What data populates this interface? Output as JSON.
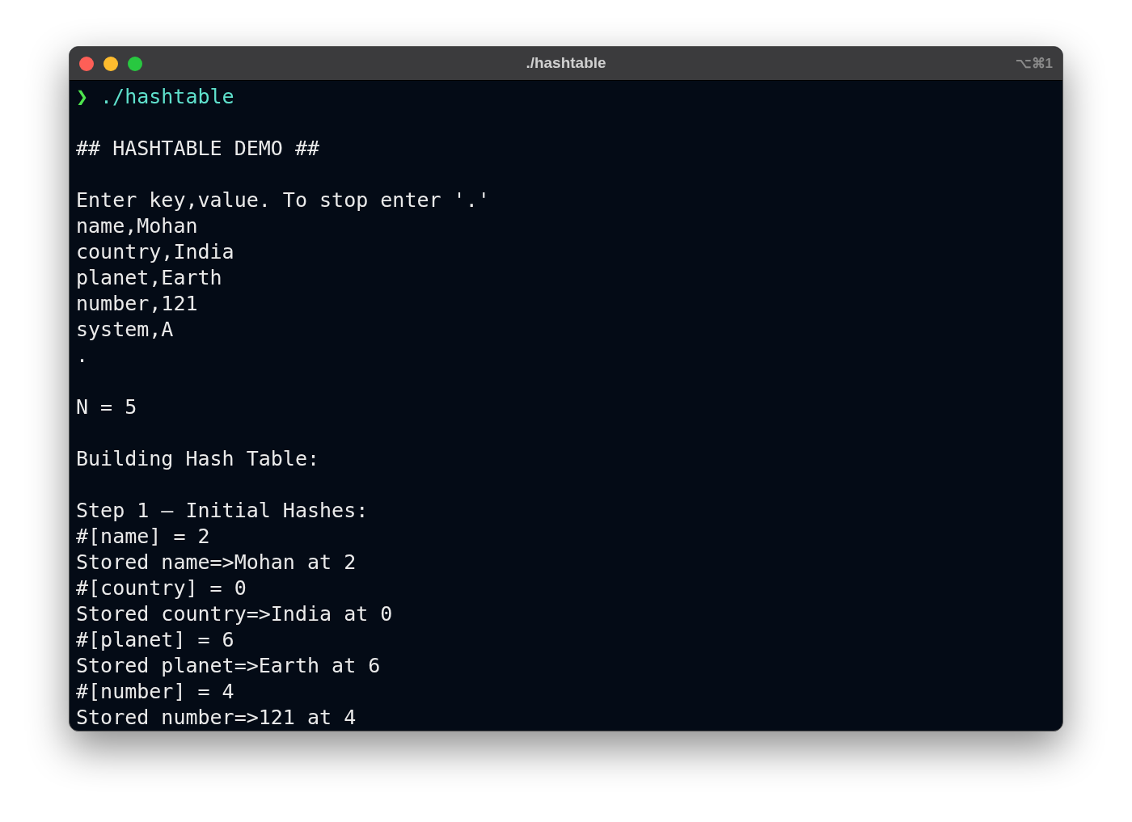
{
  "window": {
    "title": "./hashtable",
    "shortcut": "⌥⌘1"
  },
  "terminal": {
    "lines": [
      {
        "kind": "prompt",
        "symbol": "❯",
        "text": "./hashtable"
      },
      {
        "kind": "blank"
      },
      {
        "kind": "output",
        "text": "## HASHTABLE DEMO ##"
      },
      {
        "kind": "blank"
      },
      {
        "kind": "output",
        "text": "Enter key,value. To stop enter '.'"
      },
      {
        "kind": "output",
        "text": "name,Mohan"
      },
      {
        "kind": "output",
        "text": "country,India"
      },
      {
        "kind": "output",
        "text": "planet,Earth"
      },
      {
        "kind": "output",
        "text": "number,121"
      },
      {
        "kind": "output",
        "text": "system,A"
      },
      {
        "kind": "output",
        "text": "."
      },
      {
        "kind": "blank"
      },
      {
        "kind": "output",
        "text": "N = 5"
      },
      {
        "kind": "blank"
      },
      {
        "kind": "output",
        "text": "Building Hash Table:"
      },
      {
        "kind": "blank"
      },
      {
        "kind": "output",
        "text": "Step 1 – Initial Hashes:"
      },
      {
        "kind": "output",
        "text": "#[name] = 2"
      },
      {
        "kind": "output",
        "text": "Stored name=>Mohan at 2"
      },
      {
        "kind": "output",
        "text": "#[country] = 0"
      },
      {
        "kind": "output",
        "text": "Stored country=>India at 0"
      },
      {
        "kind": "output",
        "text": "#[planet] = 6"
      },
      {
        "kind": "output",
        "text": "Stored planet=>Earth at 6"
      },
      {
        "kind": "output",
        "text": "#[number] = 4"
      },
      {
        "kind": "output",
        "text": "Stored number=>121 at 4"
      }
    ]
  }
}
